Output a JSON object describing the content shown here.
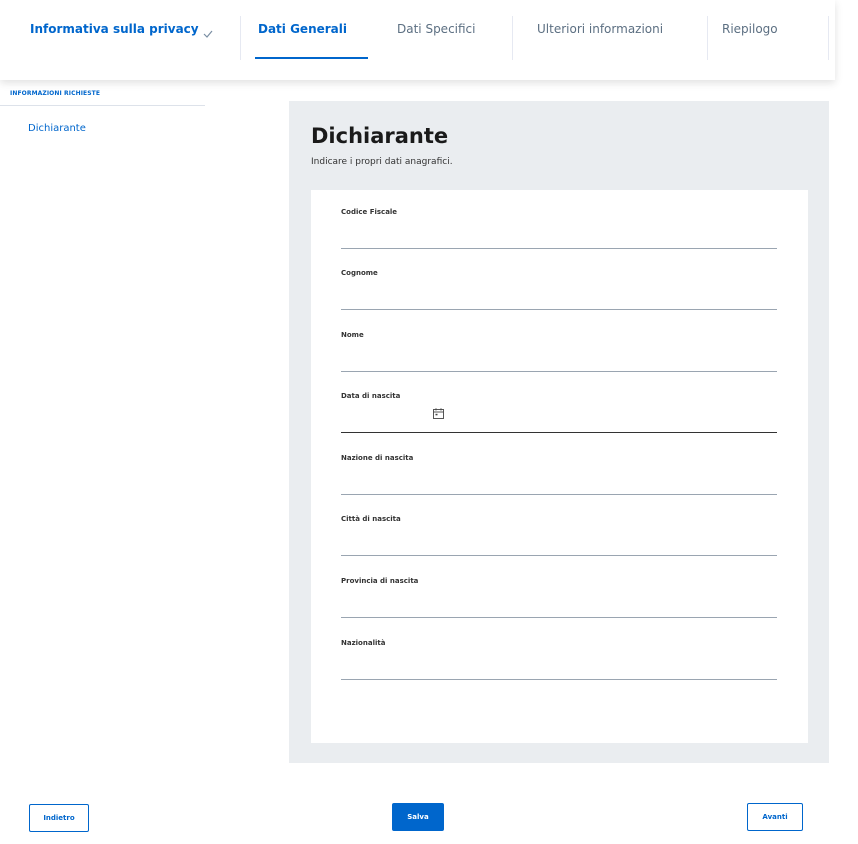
{
  "stepper": {
    "steps": [
      {
        "label": "Informativa sulla privacy",
        "completed": true
      },
      {
        "label": "Dati Generali",
        "active": true
      },
      {
        "label": "Dati Specifici"
      },
      {
        "label": "Ulteriori informazioni"
      },
      {
        "label": "Riepilogo"
      }
    ]
  },
  "sidebar": {
    "heading": "INFORMAZIONI RICHIESTE",
    "items": [
      {
        "label": "Dichiarante"
      }
    ]
  },
  "form": {
    "title": "Dichiarante",
    "subtitle": "Indicare i propri dati anagrafici.",
    "fields": [
      {
        "label": "Codice Fiscale",
        "value": ""
      },
      {
        "label": "Cognome",
        "value": ""
      },
      {
        "label": "Nome",
        "value": ""
      },
      {
        "label": "Data di nascita",
        "value": "",
        "icon": "calendar-icon"
      },
      {
        "label": "Nazione di nascita",
        "value": ""
      },
      {
        "label": "Città di nascita",
        "value": ""
      },
      {
        "label": "Provincia di nascita",
        "value": ""
      },
      {
        "label": "Nazionalità",
        "value": ""
      }
    ]
  },
  "footer": {
    "back_label": "Indietro",
    "save_label": "Salva",
    "next_label": "Avanti"
  },
  "colors": {
    "primary": "#0066cc",
    "muted_text": "#5c6f82",
    "panel_bg": "#eaedf0"
  }
}
